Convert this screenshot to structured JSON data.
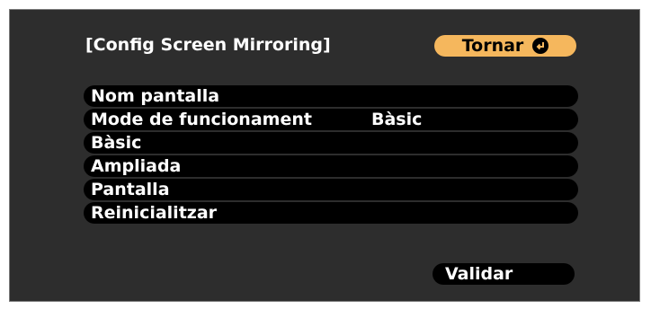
{
  "dialog": {
    "title": "[Config Screen Mirroring]",
    "back_label": "Tornar",
    "back_icon": "enter-icon"
  },
  "menu": {
    "items": [
      {
        "label": "Nom pantalla",
        "value": ""
      },
      {
        "label": "Mode de funcionament",
        "value": "Bàsic"
      },
      {
        "label": "Bàsic",
        "value": ""
      },
      {
        "label": "Ampliada",
        "value": ""
      },
      {
        "label": "Pantalla",
        "value": ""
      },
      {
        "label": "Reinicialitzar",
        "value": ""
      }
    ]
  },
  "footer": {
    "validate_label": "Validar"
  },
  "colors": {
    "background": "#2d2d2d",
    "item_bg": "#000000",
    "highlight": "#f5b75d",
    "text": "#ffffff"
  }
}
